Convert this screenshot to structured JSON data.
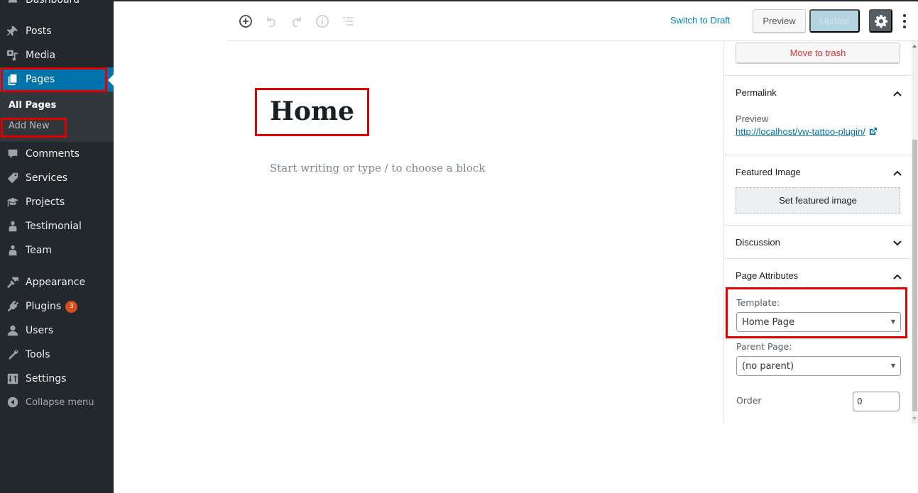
{
  "admin_menu": {
    "items": [
      {
        "id": "dashboard",
        "label": "Dashboard",
        "icon": "dashboard-icon"
      },
      {
        "id": "posts",
        "label": "Posts",
        "icon": "pin-icon"
      },
      {
        "id": "media",
        "label": "Media",
        "icon": "media-icon"
      },
      {
        "id": "pages",
        "label": "Pages",
        "icon": "pages-icon",
        "current": true
      },
      {
        "id": "comments",
        "label": "Comments",
        "icon": "comment-icon"
      },
      {
        "id": "services",
        "label": "Services",
        "icon": "tag-icon"
      },
      {
        "id": "projects",
        "label": "Projects",
        "icon": "graduation-cap-icon"
      },
      {
        "id": "testimonial",
        "label": "Testimonial",
        "icon": "person-icon"
      },
      {
        "id": "team",
        "label": "Team",
        "icon": "person-icon"
      },
      {
        "id": "appearance",
        "label": "Appearance",
        "icon": "paintbrush-icon"
      },
      {
        "id": "plugins",
        "label": "Plugins",
        "icon": "plug-icon",
        "badge": "3"
      },
      {
        "id": "users",
        "label": "Users",
        "icon": "user-icon"
      },
      {
        "id": "tools",
        "label": "Tools",
        "icon": "wrench-icon"
      },
      {
        "id": "settings",
        "label": "Settings",
        "icon": "sliders-icon"
      }
    ],
    "submenu": [
      {
        "label": "All Pages",
        "current": true
      },
      {
        "label": "Add New"
      }
    ],
    "collapse_label": "Collapse menu"
  },
  "header": {
    "switch_to_draft": "Switch to Draft",
    "preview": "Preview",
    "update": "Update",
    "icons": [
      "add-block-icon",
      "undo-icon",
      "redo-icon",
      "info-icon",
      "outline-icon"
    ]
  },
  "editor": {
    "title": "Home",
    "block_placeholder": "Start writing or type / to choose a block"
  },
  "settings_sidebar": {
    "move_to_trash": "Move to trash",
    "permalink": {
      "title": "Permalink",
      "preview_label": "Preview",
      "url": "http://localhost/vw-tattoo-plugin/"
    },
    "featured_image": {
      "title": "Featured Image",
      "button": "Set featured image"
    },
    "discussion": {
      "title": "Discussion"
    },
    "page_attributes": {
      "title": "Page Attributes",
      "template_label": "Template:",
      "template_value": "Home Page",
      "parent_label": "Parent Page:",
      "parent_value": "(no parent)",
      "order_label": "Order",
      "order_value": "0"
    }
  },
  "colors": {
    "admin_bg": "#23282d",
    "submenu_bg": "#32373c",
    "accent": "#0073aa",
    "highlight_box": "#e10000",
    "trash_red": "#dc3232",
    "badge": "#d54e21"
  }
}
